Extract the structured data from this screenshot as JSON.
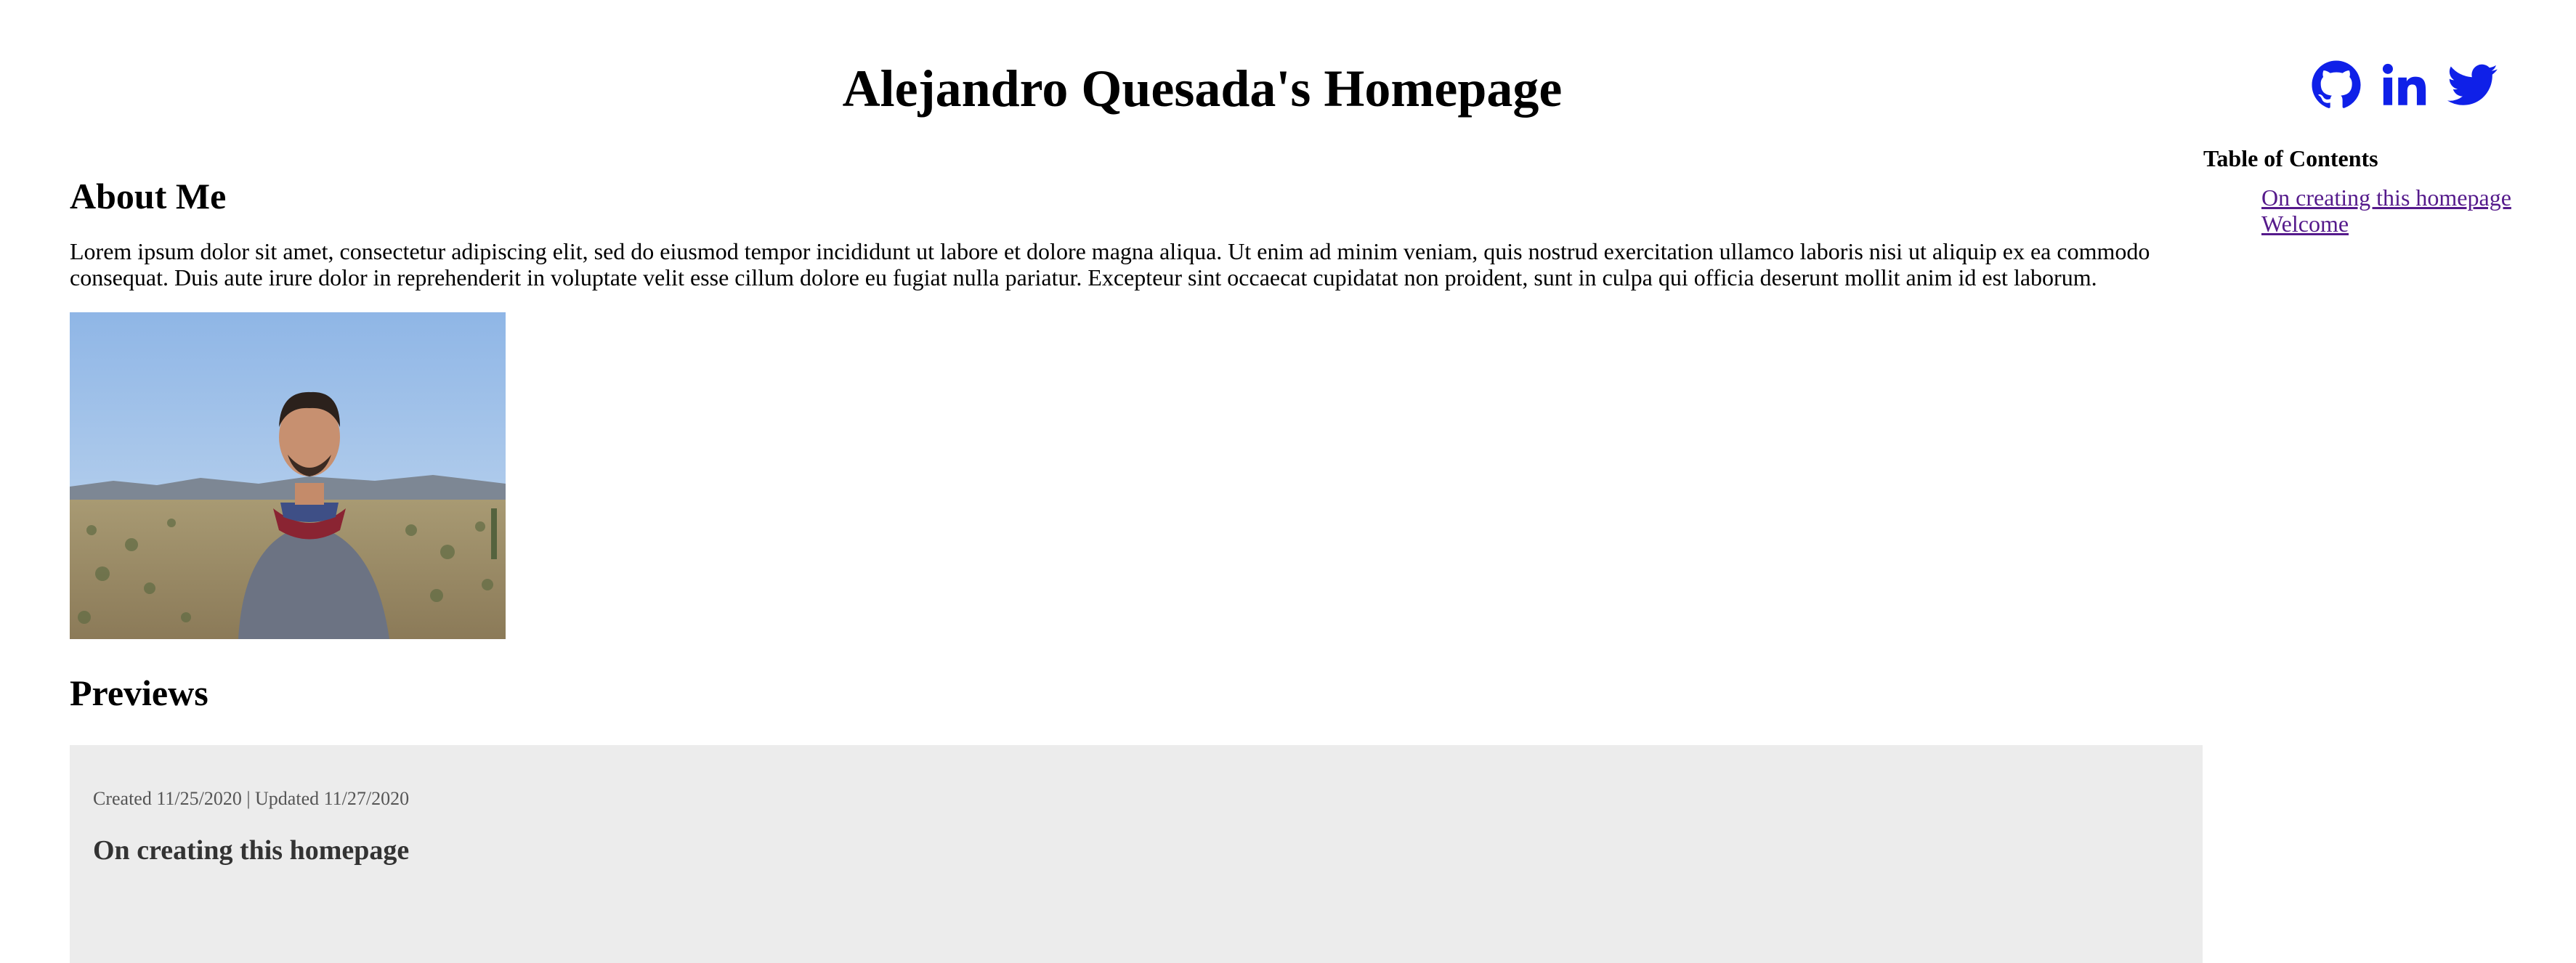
{
  "header": {
    "title": "Alejandro Quesada's Homepage",
    "social_links": [
      {
        "name": "GitHub",
        "icon": "github-icon"
      },
      {
        "name": "LinkedIn",
        "icon": "linkedin-icon"
      },
      {
        "name": "Twitter",
        "icon": "twitter-icon"
      }
    ],
    "accent_color": "#0f20e8"
  },
  "about": {
    "heading": "About Me",
    "body": "Lorem ipsum dolor sit amet, consectetur adipiscing elit, sed do eiusmod tempor incididunt ut labore et dolore magna aliqua. Ut enim ad minim veniam, quis nostrud exercitation ullamco laboris nisi ut aliquip ex ea commodo consequat. Duis aute irure dolor in reprehenderit in voluptate velit esse cillum dolore eu fugiat nulla pariatur. Excepteur sint occaecat cupidatat non proident, sunt in culpa qui officia deserunt mollit anim id est laborum."
  },
  "previews": {
    "heading": "Previews",
    "items": [
      {
        "meta": "Created 11/25/2020 | Updated 11/27/2020",
        "title": "On creating this homepage"
      }
    ]
  },
  "toc": {
    "title": "Table of Contents",
    "items": [
      "On creating this homepage",
      "Welcome"
    ]
  }
}
